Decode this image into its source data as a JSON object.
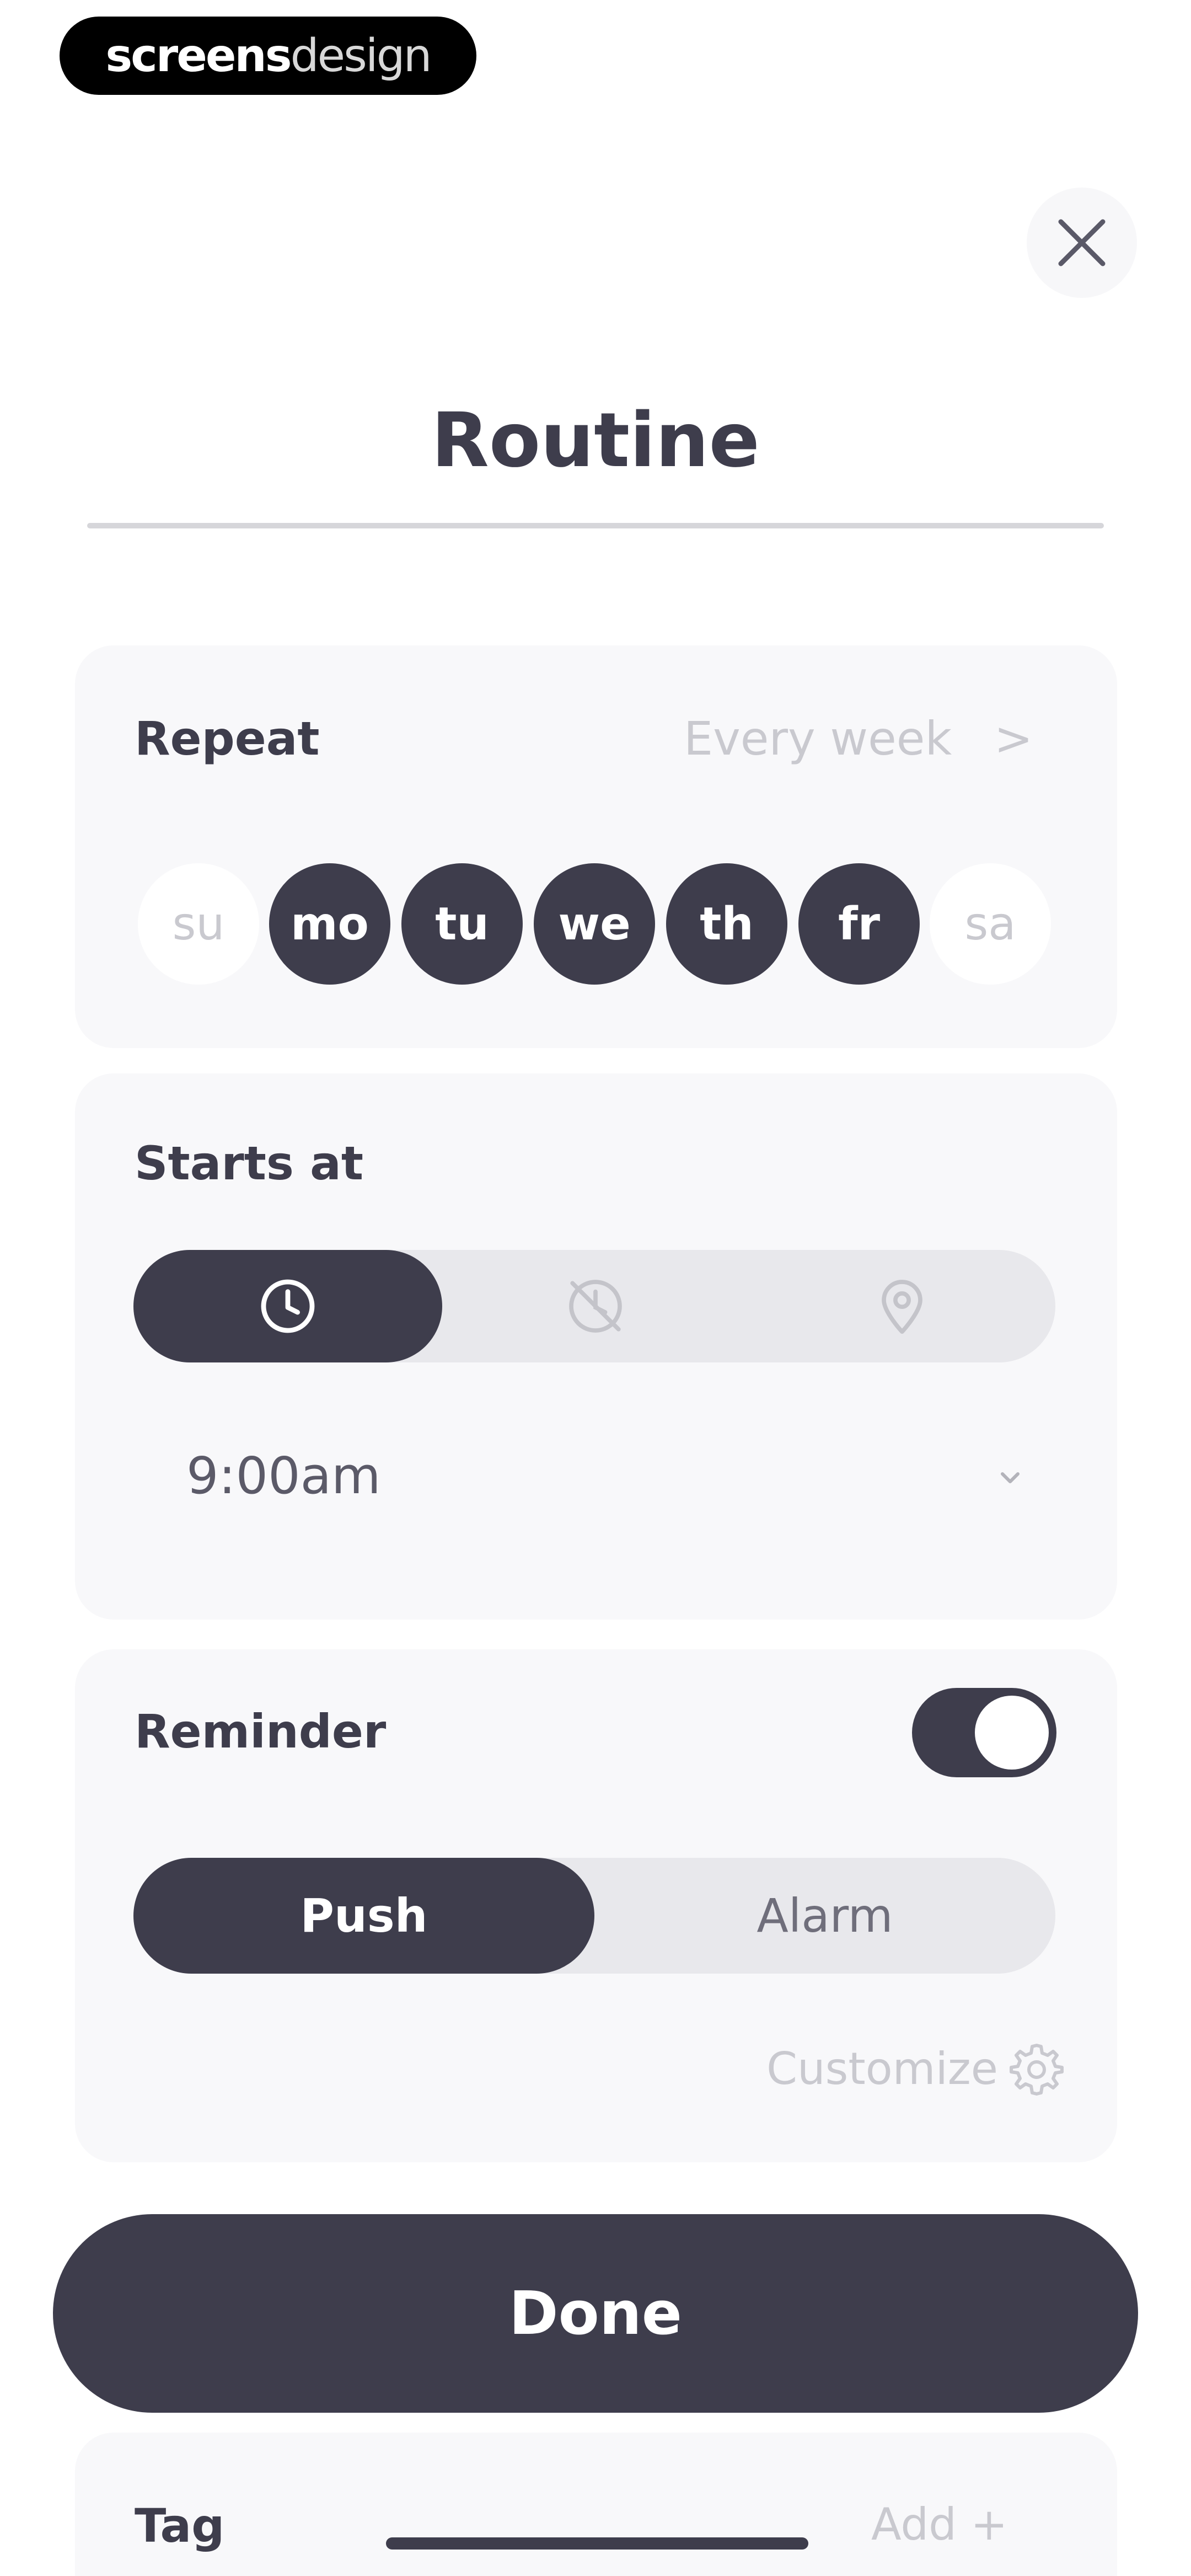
{
  "watermark": {
    "part1": "screens",
    "part2": "design"
  },
  "header": {
    "title": "Routine",
    "close_icon": "close-icon"
  },
  "repeat": {
    "label": "Repeat",
    "frequency": "Every week",
    "chevron": ">",
    "days": [
      {
        "label": "su",
        "selected": false
      },
      {
        "label": "mo",
        "selected": true
      },
      {
        "label": "tu",
        "selected": true
      },
      {
        "label": "we",
        "selected": true
      },
      {
        "label": "th",
        "selected": true
      },
      {
        "label": "fr",
        "selected": true
      },
      {
        "label": "sa",
        "selected": false
      }
    ]
  },
  "starts_at": {
    "label": "Starts at",
    "modes": [
      {
        "icon": "clock-icon",
        "active": true
      },
      {
        "icon": "clock-off-icon",
        "active": false
      },
      {
        "icon": "location-pin-icon",
        "active": false
      }
    ],
    "time": "9:00am"
  },
  "reminder": {
    "label": "Reminder",
    "enabled": true,
    "types": [
      {
        "label": "Push",
        "active": true
      },
      {
        "label": "Alarm",
        "active": false
      }
    ],
    "customize": "Customize"
  },
  "done_label": "Done",
  "tag": {
    "label": "Tag",
    "add": "Add +"
  },
  "colors": {
    "primary": "#3e3d4c",
    "card": "#f8f8fa",
    "segment": "#e8e8ec",
    "muted": "#c9c9cf"
  }
}
